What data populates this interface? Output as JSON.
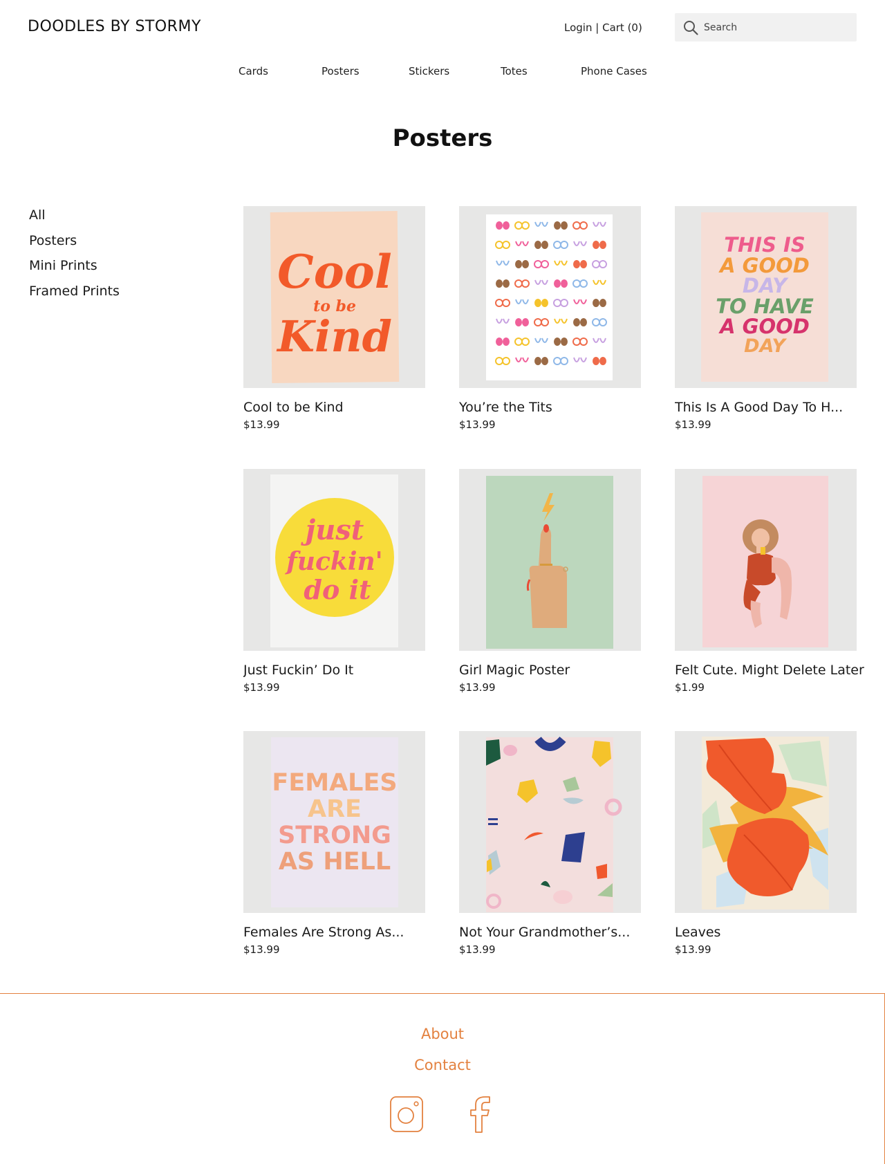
{
  "header": {
    "logo": "DOODLES BY STORMY",
    "login_label": "Login",
    "separator": "|",
    "cart_label": "Cart (0)",
    "search_placeholder": "Search"
  },
  "nav": [
    "Cards",
    "Posters",
    "Stickers",
    "Totes",
    "Phone Cases"
  ],
  "page": {
    "title": "Posters"
  },
  "sidebar": [
    "All",
    "Posters",
    "Mini Prints",
    "Framed Prints"
  ],
  "products": [
    {
      "name": "Cool to be Kind",
      "price": "$13.99"
    },
    {
      "name": "You’re the Tits",
      "price": "$13.99"
    },
    {
      "name": "This Is A Good Day To H...",
      "price": "$13.99"
    },
    {
      "name": "Just Fuckin’ Do It",
      "price": "$13.99"
    },
    {
      "name": "Girl Magic Poster",
      "price": "$13.99"
    },
    {
      "name": "Felt Cute. Might Delete Later",
      "price": "$1.99"
    },
    {
      "name": "Females Are Strong As...",
      "price": "$13.99"
    },
    {
      "name": "Not Your Grandmother’s...",
      "price": "$13.99"
    },
    {
      "name": "Leaves",
      "price": "$13.99"
    }
  ],
  "artwork": {
    "cool": [
      "Cool",
      "to be",
      "Kind"
    ],
    "good_day": [
      "THIS IS",
      "A GOOD",
      "DAY",
      "TO HAVE",
      "A GOOD",
      "DAY"
    ],
    "jfdi": [
      "just",
      "fuckin'",
      "do it"
    ],
    "females": [
      "FEMALES",
      "ARE",
      "STRONG",
      "AS HELL"
    ]
  },
  "footer": {
    "about": "About",
    "contact": "Contact"
  },
  "colors": {
    "accent": "#e3813f",
    "tile_bg": "#e7e7e6",
    "search_bg": "#f1f1f1"
  }
}
